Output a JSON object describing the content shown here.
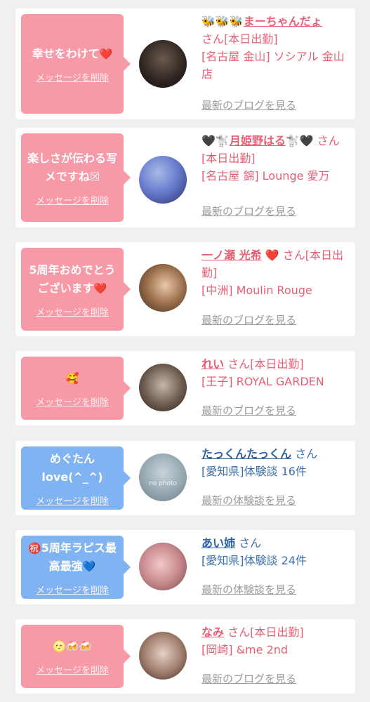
{
  "items": [
    {
      "bubble_text": "幸せをわけて",
      "bubble_emoji": "❤️",
      "delete_label": "メッセージを削除",
      "name_prefix": "🐝🐝🐝",
      "name": "まーちゃんだょ",
      "suffix": "さん",
      "status": "[本日出勤]",
      "location": "[名古屋 金山] ソシアル 金山店",
      "link_label": "最新のブログを見る",
      "theme": "pink"
    },
    {
      "bubble_text": "楽しさが伝わる写メですね☒",
      "bubble_emoji": "",
      "delete_label": "メッセージを削除",
      "name_prefix": "🖤🐩",
      "name": "月姫野はる",
      "name_suffix": "🐩🖤",
      "suffix": "さん",
      "status": "[本日出勤]",
      "location": "[名古屋 錦] Lounge 愛万",
      "link_label": "最新のブログを見る",
      "theme": "pink"
    },
    {
      "bubble_text": "5周年おめでとうございます",
      "bubble_emoji": "❤️",
      "delete_label": "メッセージを削除",
      "name_prefix": "",
      "name": "一ノ瀬 光希",
      "name_suffix": "❤️",
      "suffix": "さん",
      "status": "[本日出勤]",
      "location": "[中洲] Moulin Rouge",
      "link_label": "最新のブログを見る",
      "theme": "pink"
    },
    {
      "bubble_text": "",
      "bubble_emoji": "🥰",
      "delete_label": "メッセージを削除",
      "name_prefix": "",
      "name": "れい",
      "suffix": "さん",
      "status": "[本日出勤]",
      "location": "[王子] ROYAL GARDEN",
      "link_label": "最新のブログを見る",
      "theme": "pink"
    },
    {
      "bubble_text": "めぐたんlove(^_^)",
      "bubble_emoji": "",
      "delete_label": "メッセージを削除",
      "name_prefix": "",
      "name": "たっくんたっくん",
      "suffix": "さん",
      "status": "",
      "location": "[愛知県]体験談 16件",
      "link_label": "最新の体験談を見る",
      "avatar_text": "no photo",
      "theme": "blue"
    },
    {
      "bubble_text": "5周年ラピス最高最強",
      "bubble_emoji_pre": "㊗️",
      "bubble_emoji": "💙",
      "delete_label": "メッセージを削除",
      "name_prefix": "",
      "name": "あい姉",
      "suffix": "さん",
      "status": "",
      "location": "[愛知県]体験談 24件",
      "link_label": "最新の体験談を見る",
      "theme": "blue"
    },
    {
      "bubble_text": "",
      "bubble_emoji": "🌝🍻🍻",
      "delete_label": "メッセージを削除",
      "name_prefix": "",
      "name": "なみ",
      "suffix": "さん",
      "status": "[本日出勤]",
      "location": "[岡崎] &me 2nd",
      "link_label": "最新のブログを見る",
      "theme": "pink"
    }
  ],
  "colors": {
    "pink_bubble": "#f799a7",
    "blue_bubble": "#7fb3f1",
    "pink_text": "#e65f73",
    "blue_text": "#3d6ea7",
    "link_gray": "#9a9a9a"
  }
}
